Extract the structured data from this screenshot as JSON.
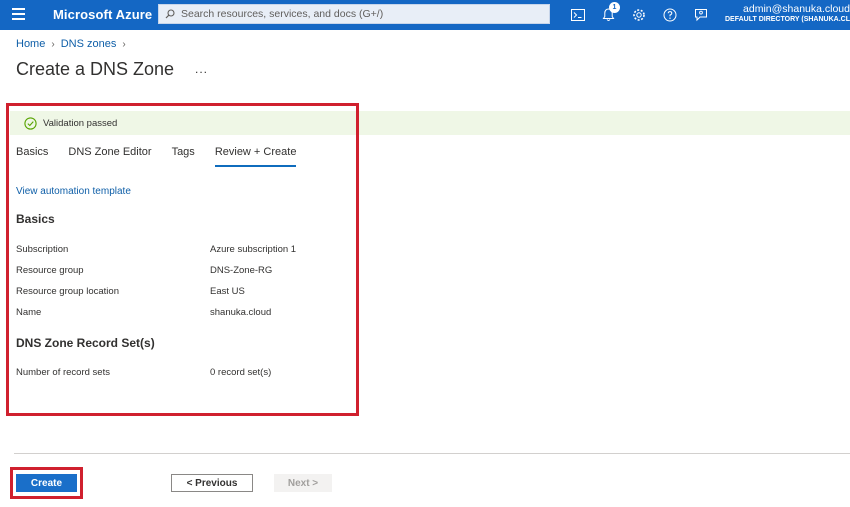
{
  "topbar": {
    "brand": "Microsoft Azure",
    "search_placeholder": "Search resources, services, and docs (G+/)",
    "notification_count": "1",
    "account_email": "admin@shanuka.cloud",
    "account_directory": "DEFAULT DIRECTORY (SHANUKA.CLOUD)",
    "icons": [
      "menu-icon",
      "search-icon",
      "cloud-shell-icon",
      "bell-icon",
      "gear-icon",
      "help-icon",
      "feedback-icon"
    ]
  },
  "breadcrumb": {
    "items": [
      "Home",
      "DNS zones"
    ]
  },
  "page": {
    "title": "Create a DNS Zone",
    "more_label": "..."
  },
  "banner": {
    "text": "Validation passed"
  },
  "tabs": [
    {
      "label": "Basics",
      "active": false
    },
    {
      "label": "DNS Zone Editor",
      "active": false
    },
    {
      "label": "Tags",
      "active": false
    },
    {
      "label": "Review + Create",
      "active": true
    }
  ],
  "automation_link": "View automation template",
  "basics": {
    "title": "Basics",
    "rows": [
      {
        "label": "Subscription",
        "value": "Azure subscription 1"
      },
      {
        "label": "Resource group",
        "value": "DNS-Zone-RG"
      },
      {
        "label": "Resource group location",
        "value": "East US"
      },
      {
        "label": "Name",
        "value": "shanuka.cloud"
      }
    ]
  },
  "record_sets": {
    "title": "DNS Zone Record Set(s)",
    "rows": [
      {
        "label": "Number of record sets",
        "value": "0 record set(s)"
      }
    ]
  },
  "footer": {
    "create_label": "Create",
    "previous_label": "< Previous",
    "next_label": "Next >"
  },
  "colors": {
    "header": "#1467c4",
    "accent": "#0f6cbd",
    "success_bg": "#eff7e6",
    "success_icon": "#57a300",
    "highlight": "#d0202e"
  }
}
